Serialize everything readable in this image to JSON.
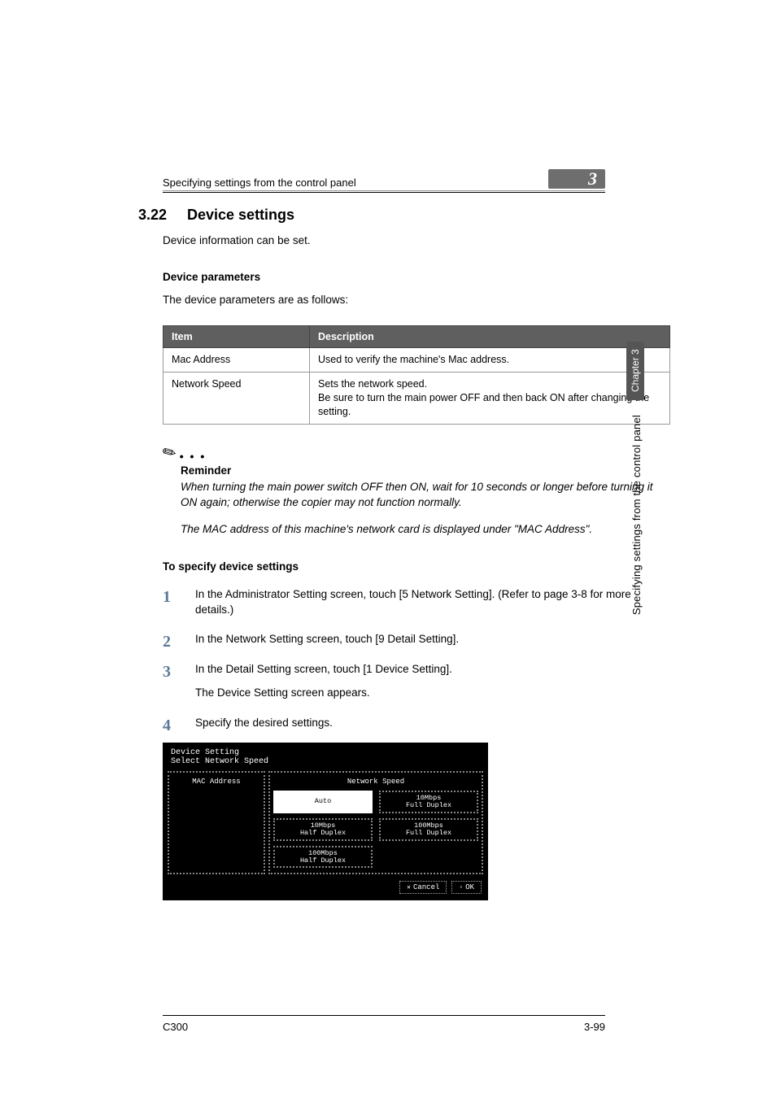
{
  "header": {
    "breadcrumb": "Specifying settings from the control panel",
    "chapter_badge": "3"
  },
  "section": {
    "number": "3.22",
    "title": "Device settings",
    "intro": "Device information can be set."
  },
  "params": {
    "heading": "Device parameters",
    "intro": "The device parameters are as follows:",
    "table": {
      "head": {
        "item": "Item",
        "desc": "Description"
      },
      "rows": [
        {
          "item": "Mac Address",
          "desc": "Used to verify the machine's Mac address."
        },
        {
          "item": "Network Speed",
          "desc": "Sets the network speed.\nBe sure to turn the main power OFF and then back ON after changing the setting."
        }
      ]
    }
  },
  "note": {
    "label": "Reminder",
    "para1": "When turning the main power switch OFF then ON, wait for 10 seconds or longer before turning it ON again; otherwise the copier may not function normally.",
    "para2": "The MAC address of this machine's network card is displayed under \"MAC Address\"."
  },
  "procedure": {
    "heading": "To specify device settings",
    "steps": [
      {
        "n": "1",
        "text": "In the Administrator Setting screen, touch [5 Network Setting]. (Refer to page 3-8 for more details.)"
      },
      {
        "n": "2",
        "text": "In the Network Setting screen, touch [9 Detail Setting]."
      },
      {
        "n": "3",
        "text": "In the Detail Setting screen, touch [1 Device Setting].",
        "sub": "The Device Setting screen appears."
      },
      {
        "n": "4",
        "text": "Specify the desired settings."
      }
    ]
  },
  "screenshot": {
    "title": "Device Setting",
    "subtitle": "Select Network Speed",
    "left_head": "MAC Address",
    "right_head": "Network Speed",
    "buttons": [
      {
        "label": "Auto",
        "selected": true
      },
      {
        "label": "10Mbps\nFull Duplex",
        "selected": false
      },
      {
        "label": "10Mbps\nHalf Duplex",
        "selected": false
      },
      {
        "label": "100Mbps\nFull Duplex",
        "selected": false
      },
      {
        "label": "100Mbps\nHalf Duplex",
        "selected": false
      }
    ],
    "cancel": "Cancel",
    "ok": "OK"
  },
  "side": {
    "tab": "Chapter 3",
    "caption": "Specifying settings from the control panel"
  },
  "footer": {
    "left": "C300",
    "right": "3-99"
  }
}
